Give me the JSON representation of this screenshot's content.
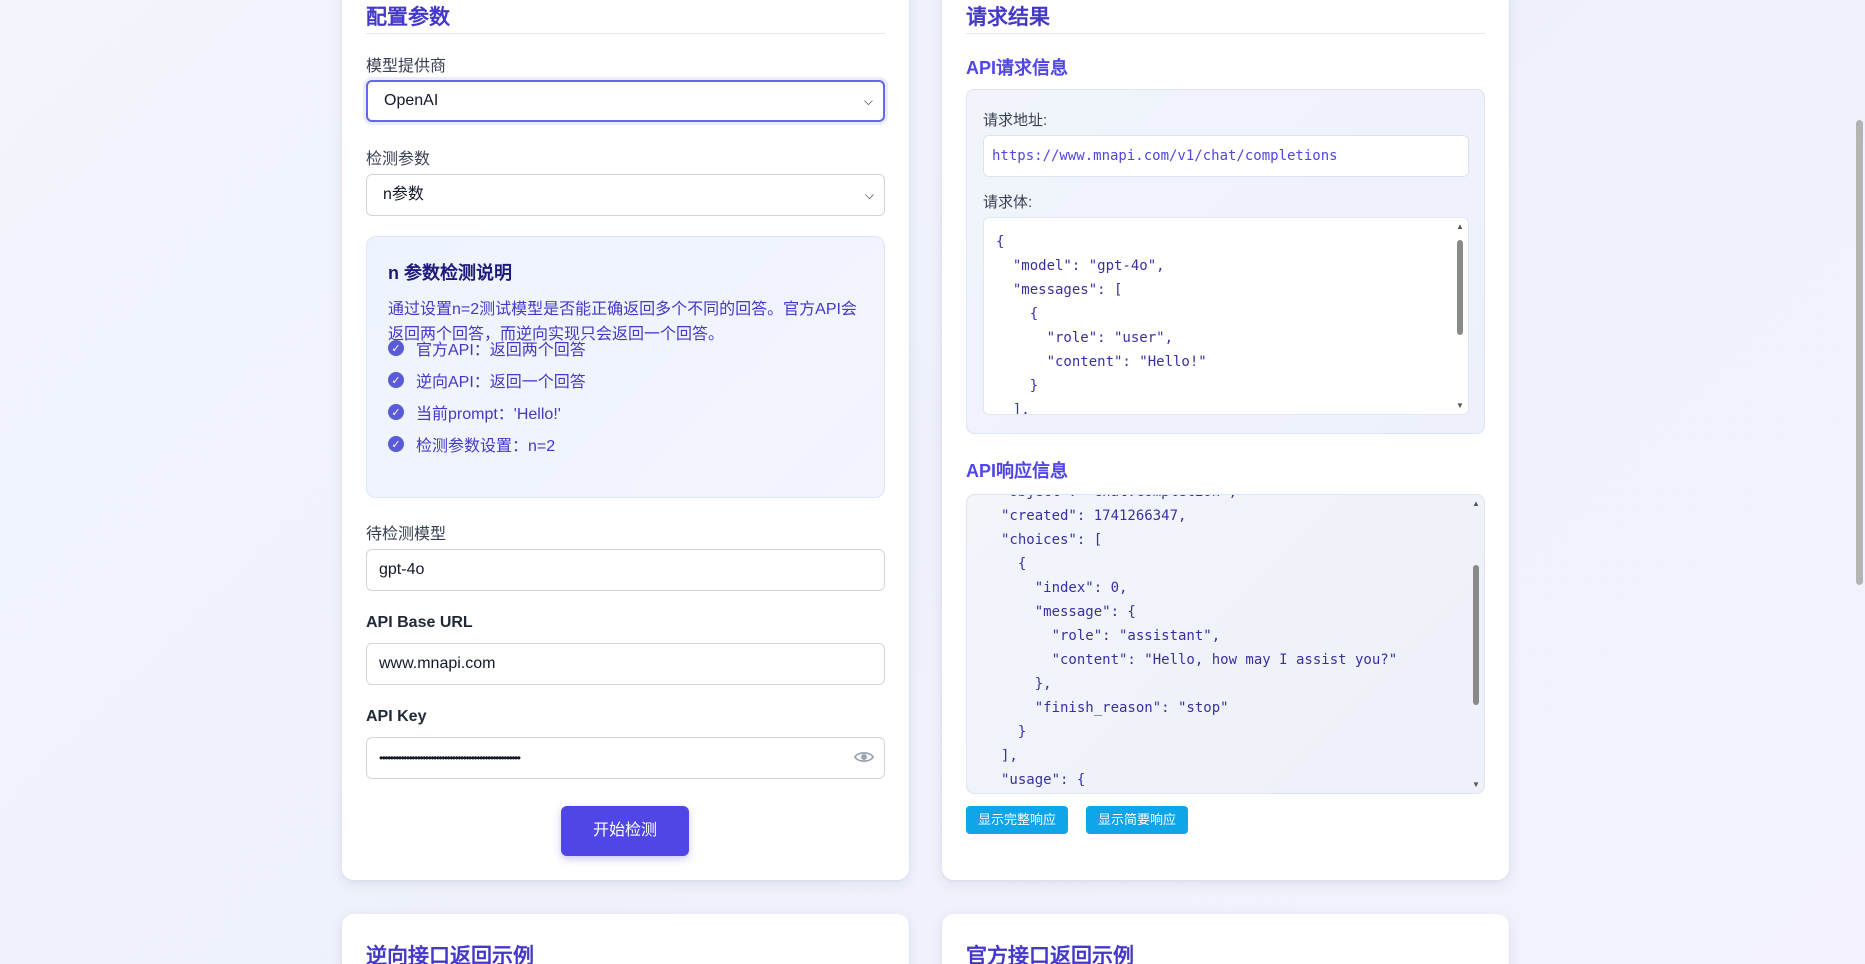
{
  "config": {
    "title": "配置参数",
    "provider_label": "模型提供商",
    "provider_value": "OpenAI",
    "param_label": "检测参数",
    "param_value": "n参数",
    "info": {
      "title": "n 参数检测说明",
      "description": "通过设置n=2测试模型是否能正确返回多个不同的回答。官方API会返回两个回答，而逆向实现只会返回一个回答。",
      "items": [
        "官方API：返回两个回答",
        "逆向API：返回一个回答",
        "当前prompt：'Hello!'",
        "检测参数设置：n=2"
      ]
    },
    "model_label": "待检测模型",
    "model_value": "gpt-4o",
    "base_url_label": "API Base URL",
    "base_url_value": "www.mnapi.com",
    "key_label": "API Key",
    "key_value": "••••••••••••••••••••••••••••••••••••••••••••••••••••",
    "start_button": "开始检测"
  },
  "result": {
    "title": "请求结果",
    "request_title": "API请求信息",
    "url_label": "请求地址:",
    "url_value": "https://www.mnapi.com/v1/chat/completions",
    "body_label": "请求体:",
    "body_code": "{\n  \"model\": \"gpt-4o\",\n  \"messages\": [\n    {\n      \"role\": \"user\",\n      \"content\": \"Hello!\"\n    }\n  ],",
    "response_title": "API响应信息",
    "response_code": "\"object\": \"chat.completion\",\n\"created\": 1741266347,\n\"choices\": [\n  {\n    \"index\": 0,\n    \"message\": {\n      \"role\": \"assistant\",\n      \"content\": \"Hello, how may I assist you?\"\n    },\n    \"finish_reason\": \"stop\"\n  }\n],\n\"usage\": {",
    "full_button": "显示完整响应",
    "brief_button": "显示简要响应"
  },
  "bottom": {
    "left_title": "逆向接口返回示例",
    "right_title": "官方接口返回示例"
  },
  "colors": {
    "accent": "#4f46e5",
    "title": "#4338ca",
    "pill": "#0ea5e9"
  }
}
